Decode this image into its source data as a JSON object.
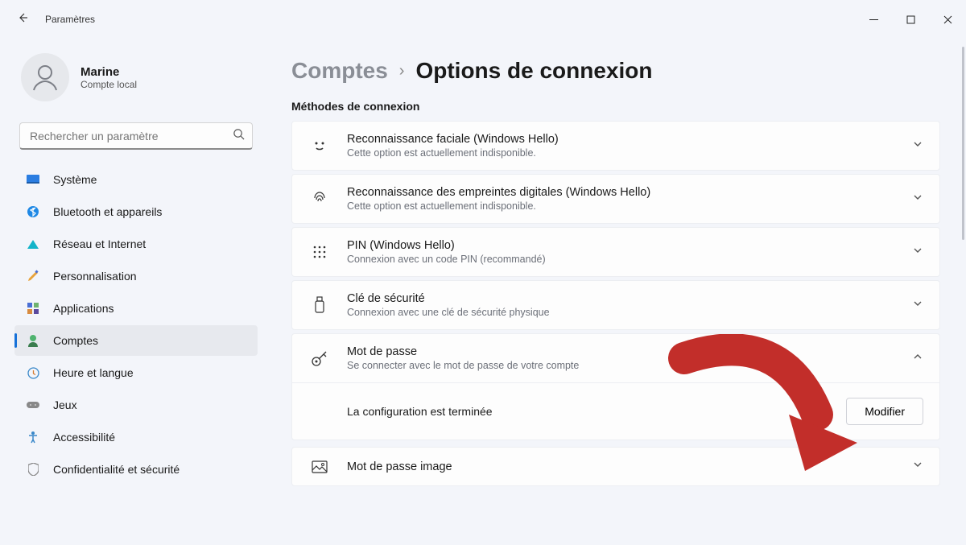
{
  "window": {
    "title": "Paramètres"
  },
  "user": {
    "name": "Marine",
    "account_type": "Compte local"
  },
  "search": {
    "placeholder": "Rechercher un paramètre"
  },
  "sidebar": {
    "items": [
      {
        "label": "Système"
      },
      {
        "label": "Bluetooth et appareils"
      },
      {
        "label": "Réseau et Internet"
      },
      {
        "label": "Personnalisation"
      },
      {
        "label": "Applications"
      },
      {
        "label": "Comptes"
      },
      {
        "label": "Heure et langue"
      },
      {
        "label": "Jeux"
      },
      {
        "label": "Accessibilité"
      },
      {
        "label": "Confidentialité et sécurité"
      }
    ]
  },
  "breadcrumb": {
    "parent": "Comptes",
    "current": "Options de connexion"
  },
  "section_heading": "Méthodes de connexion",
  "methods": {
    "face": {
      "title": "Reconnaissance faciale (Windows Hello)",
      "sub": "Cette option est actuellement indisponible."
    },
    "fingerprint": {
      "title": "Reconnaissance des empreintes digitales (Windows Hello)",
      "sub": "Cette option est actuellement indisponible."
    },
    "pin": {
      "title": "PIN (Windows Hello)",
      "sub": "Connexion avec un code PIN (recommandé)"
    },
    "security_key": {
      "title": "Clé de sécurité",
      "sub": "Connexion avec une clé de sécurité physique"
    },
    "password": {
      "title": "Mot de passe",
      "sub": "Se connecter avec le mot de passe de votre compte",
      "done_text": "La configuration est terminée",
      "modify_label": "Modifier"
    },
    "picture_password": {
      "title": "Mot de passe image"
    }
  }
}
